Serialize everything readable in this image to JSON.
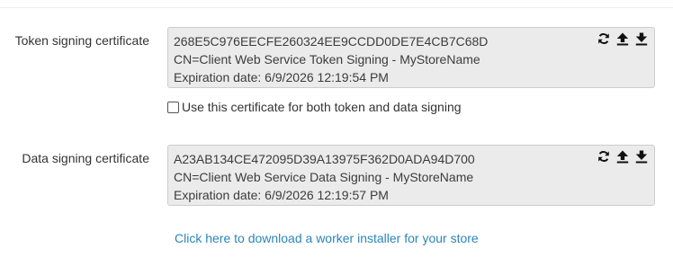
{
  "token_signing": {
    "label": "Token signing certificate",
    "thumbprint": "268E5C976EECFE260324EE9CCDD0DE7E4CB7C68D",
    "subject": "CN=Client Web Service Token Signing - MyStoreName",
    "expiration": "Expiration date: 6/9/2026 12:19:54 PM",
    "use_for_both_label": "Use this certificate for both token and data signing",
    "use_for_both_checked": false
  },
  "data_signing": {
    "label": "Data signing certificate",
    "thumbprint": "A23AB134CE472095D39A13975F362D0ADA94D700",
    "subject": "CN=Client Web Service Data Signing - MyStoreName",
    "expiration": "Expiration date: 6/9/2026 12:19:57 PM"
  },
  "actions": {
    "icons": [
      "refresh-icon",
      "upload-icon",
      "download-icon"
    ]
  },
  "download_link": {
    "text": "Click here to download a worker installer for your store"
  },
  "colors": {
    "link": "#2a86b8",
    "box_bg": "#ebebeb",
    "box_border": "#cccccc"
  }
}
